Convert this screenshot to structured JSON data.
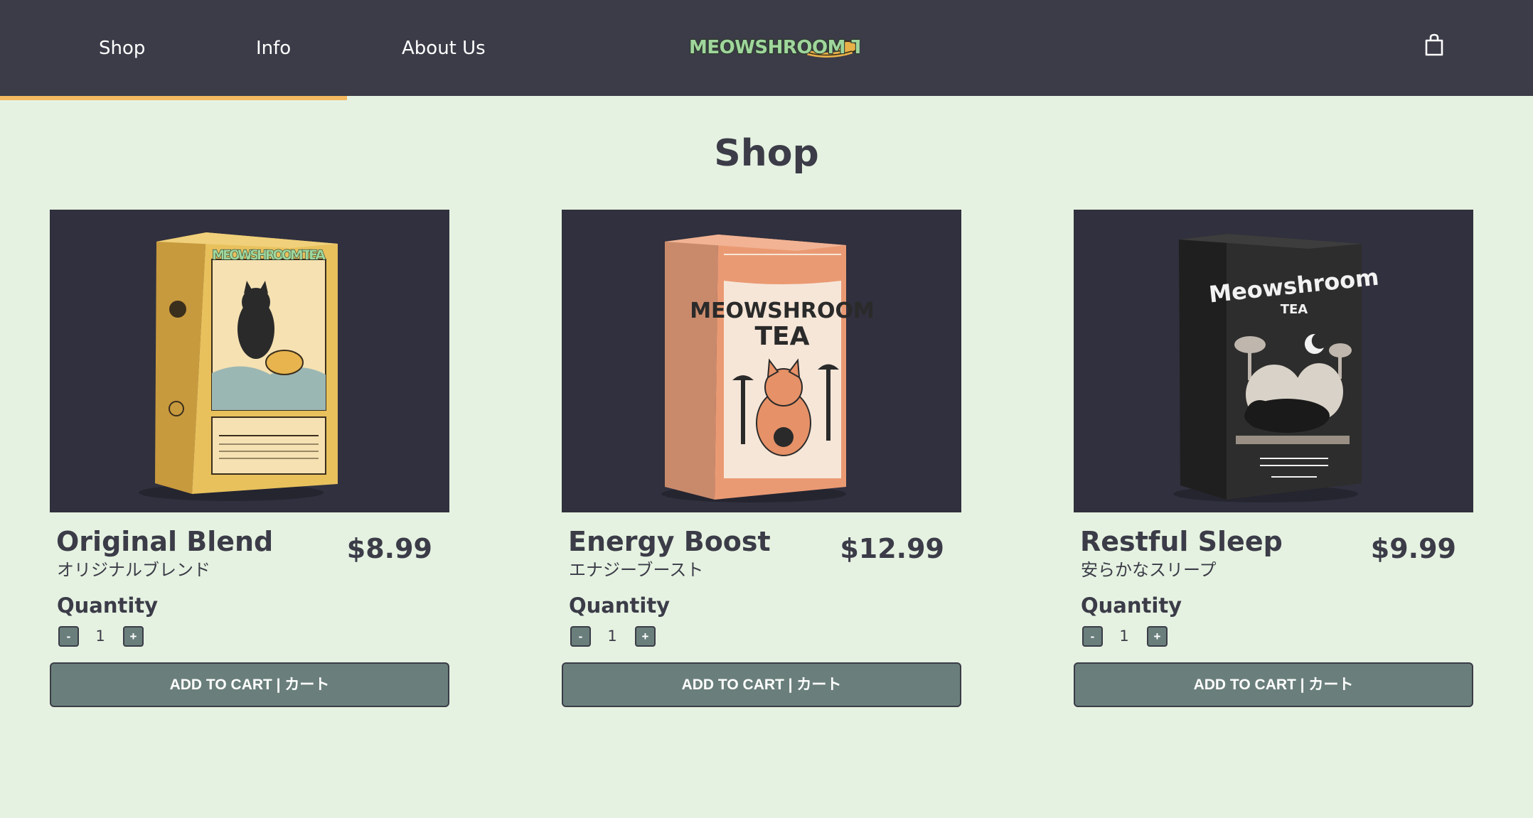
{
  "header": {
    "nav": [
      {
        "label": "Shop",
        "active": true
      },
      {
        "label": "Info",
        "active": false
      },
      {
        "label": "About Us",
        "active": false
      }
    ],
    "logo_text": "MEOWSHROOM TEA",
    "cart_icon": "shopping-bag-icon",
    "active_color": "#f5b95f"
  },
  "page": {
    "title": "Shop"
  },
  "products": [
    {
      "name": "Original Blend",
      "name_jp": "オリジナルブレンド",
      "price": "$8.99",
      "quantity_label": "Quantity",
      "quantity": "1",
      "minus_label": "-",
      "plus_label": "+",
      "add_to_cart_label": "ADD TO CART | カート",
      "box_color": "#e8c15d"
    },
    {
      "name": "Energy Boost",
      "name_jp": "エナジーブースト",
      "price": "$12.99",
      "quantity_label": "Quantity",
      "quantity": "1",
      "minus_label": "-",
      "plus_label": "+",
      "add_to_cart_label": "ADD TO CART | カート",
      "box_color": "#ea9a73"
    },
    {
      "name": "Restful Sleep",
      "name_jp": "安らかなスリープ",
      "price": "$9.99",
      "quantity_label": "Quantity",
      "quantity": "1",
      "minus_label": "-",
      "plus_label": "+",
      "add_to_cart_label": "ADD TO CART | カート",
      "box_color": "#2d2d2d"
    }
  ],
  "colors": {
    "header_bg": "#3b3c48",
    "page_bg": "#e6f2e1",
    "button_bg": "#6a7f7b",
    "text": "#3b3c48"
  }
}
